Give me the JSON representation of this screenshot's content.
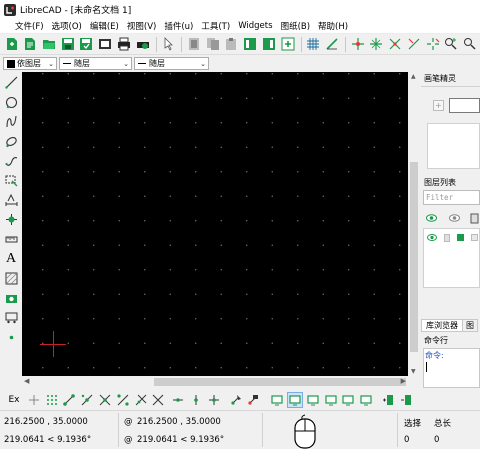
{
  "window": {
    "title": "LibreCAD - [未命名文档 1]"
  },
  "menubar": [
    "文件(F)",
    "选项(O)",
    "编辑(E)",
    "视图(V)",
    "插件(u)",
    "工具(T)",
    "Widgets",
    "图纸(B)",
    "帮助(H)"
  ],
  "toolbar2": {
    "color_value": "依图层",
    "linetype_value": "随层",
    "linewidth_value": "随层"
  },
  "left_toolbar": {
    "text_tool_label": "A"
  },
  "right_panel": {
    "pen_wizard_title": "画笔精灵",
    "layer_list_title": "图层列表",
    "filter_placeholder": "Filter",
    "tab_library_browser": "库浏览器",
    "tab_second_visible": "图",
    "command_title": "命令行",
    "command_prompt": "命令:"
  },
  "bottom_toolbar": {
    "ex_label": "Ex"
  },
  "status": {
    "abs_coord": "216.2500 , 35.0000",
    "abs_polar": "219.0641 < 9.1936°",
    "rel_prefix": "@",
    "rel_coord": "216.2500 , 35.0000",
    "rel_polar": "219.0641 < 9.1936°",
    "selected_label": "选择",
    "selected_value": "0",
    "total_label": "总长",
    "total_value": "0"
  },
  "colors": {
    "accent_green": "#1a9a4a",
    "canvas_bg": "#000000",
    "crosshair": "#c8202a",
    "active_blue": "#cde3f7"
  }
}
